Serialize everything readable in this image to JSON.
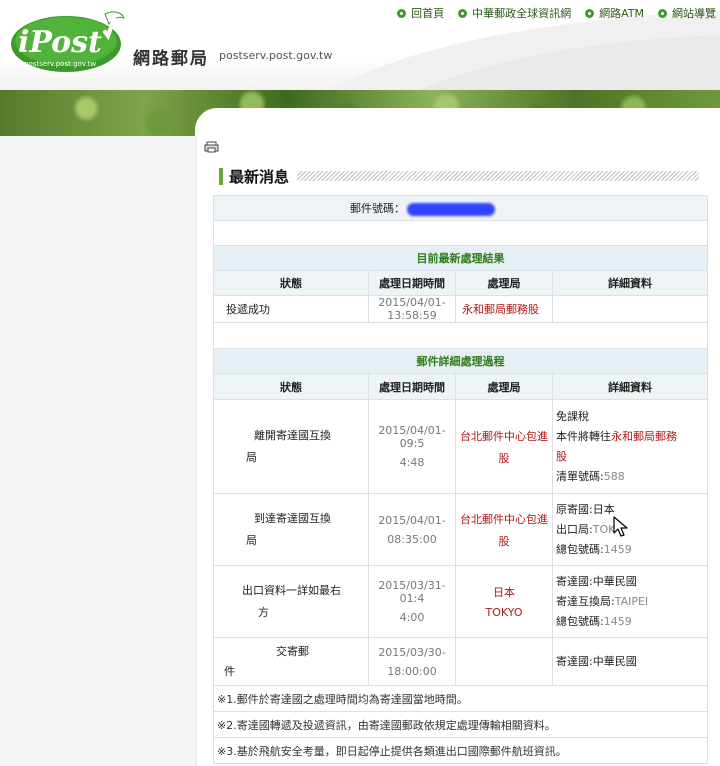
{
  "header": {
    "logo_text": "iPost",
    "logo_subtext": "postserv.post.gov.tw",
    "site_name": "網路郵局",
    "site_url": "postserv.post.gov.tw",
    "nav": [
      {
        "label": "回首頁"
      },
      {
        "label": "中華郵政全球資訊網"
      },
      {
        "label": "網路ATM"
      },
      {
        "label": "網站導覽"
      }
    ]
  },
  "section": {
    "title": "最新消息"
  },
  "tracking": {
    "label": "郵件號碼：",
    "latest": {
      "title": "目前最新處理結果",
      "headers": [
        "狀態",
        "處理日期時間",
        "處理局",
        "詳細資料"
      ],
      "row": {
        "status": "投遞成功",
        "datetime": "2015/04/01-13:58:59",
        "office": "永和郵局郵務股",
        "detail": ""
      }
    },
    "history": {
      "title": "郵件詳細處理過程",
      "headers": [
        "狀態",
        "處理日期時間",
        "處理局",
        "詳細資料"
      ],
      "rows": [
        {
          "status_l1": "離開寄達國互換",
          "status_l2": "局",
          "dt_l1": "2015/04/01-09:5",
          "dt_l2": "4:48",
          "office_l1": "台北郵件中心包進",
          "office_l2": "股",
          "d1": "免課稅",
          "d2a": "本件將轉往",
          "d2b": "永和郵局郵務",
          "d3": "股",
          "d4a": "清單號碼:",
          "d4b": "588"
        },
        {
          "status_l1": "到達寄達國互換",
          "status_l2": "局",
          "dt_l1": "2015/04/01-",
          "dt_l2": "08:35:00",
          "office_l1": "台北郵件中心包進",
          "office_l2": "股",
          "d1": "原寄國:日本",
          "d2a": "出口局:",
          "d2b": "TOK",
          "d3a": "總包號碼:",
          "d3b": "1459"
        },
        {
          "status_l1": "出口資料一詳如最右",
          "status_l2": "方",
          "dt_l1": "2015/03/31-01:4",
          "dt_l2": "4:00",
          "office_l1": "日本",
          "office_l2": "TOKYO",
          "d1": "寄達國:中華民國",
          "d2a": "寄達互換局:",
          "d2b": "TAIPEI",
          "d3a": "總包號碼:",
          "d3b": "1459"
        },
        {
          "status_l1": "交寄郵",
          "status_l2": "件",
          "dt_l1": "2015/03/30-",
          "dt_l2": "18:00:00",
          "office_l1": "",
          "office_l2": "",
          "d1": "寄達國:中華民國"
        }
      ]
    },
    "notes": [
      "※1.郵件於寄達國之處理時間均為寄達國當地時間。",
      "※2.寄達國轉遞及投遞資訊，由寄達國郵政依規定處理傳輸相關資料。",
      "※3.基於飛航安全考量，即日起停止提供各類進出口國際郵件航班資訊。"
    ]
  }
}
